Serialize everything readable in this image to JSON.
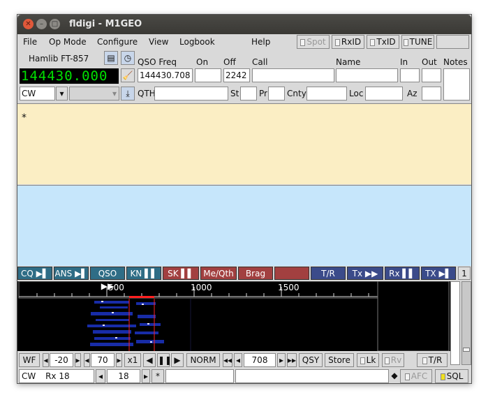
{
  "window": {
    "title": "fldigi - M1GEO"
  },
  "menu": {
    "file": "File",
    "op_mode": "Op Mode",
    "configure": "Configure",
    "view": "View",
    "logbook": "Logbook",
    "help": "Help"
  },
  "toolbar": {
    "spot": "Spot",
    "rxid": "RxID",
    "txid": "TxID",
    "tune": "TUNE"
  },
  "rig": {
    "name": "Hamlib FT-857",
    "frequency": "144430.000",
    "mode": "CW"
  },
  "log": {
    "qso_freq_label": "QSO Freq",
    "qso_freq": "144430.708",
    "on_label": "On",
    "on": "",
    "off_label": "Off",
    "off": "2242",
    "call_label": "Call",
    "call": "",
    "name_label": "Name",
    "name": "",
    "in_label": "In",
    "in": "",
    "out_label": "Out",
    "out": "",
    "notes_label": "Notes",
    "qth_label": "QTH",
    "st_label": "St",
    "pr_label": "Pr",
    "cnty_label": "Cnty",
    "loc_label": "Loc",
    "az_label": "Az"
  },
  "rx_text": "*",
  "macros": [
    {
      "label": "CQ ▶▌",
      "color": "#2f6d86"
    },
    {
      "label": "ANS ▶▌",
      "color": "#2f6d86"
    },
    {
      "label": "QSO ▶▶",
      "color": "#2f6d86"
    },
    {
      "label": "KN ▌▌",
      "color": "#2f6d86"
    },
    {
      "label": "SK ▌▌",
      "color": "#a24040"
    },
    {
      "label": "Me/Qth",
      "color": "#a24040"
    },
    {
      "label": "Brag",
      "color": "#a24040"
    },
    {
      "label": "",
      "color": "#a24040"
    },
    {
      "label": "T/R",
      "color": "#3b4b8a"
    },
    {
      "label": "Tx ▶▶",
      "color": "#3b4b8a"
    },
    {
      "label": "Rx ▌▌",
      "color": "#3b4b8a"
    },
    {
      "label": "TX ▶▌",
      "color": "#3b4b8a"
    }
  ],
  "macro_page": "1",
  "waterfall": {
    "scale_labels": [
      "500",
      "1000",
      "1500"
    ],
    "wf_button": "WF",
    "ref_level": "-20",
    "range": "70",
    "zoom": "x1",
    "norm": "NORM",
    "carrier": "708",
    "qsy": "QSY",
    "store": "Store",
    "lk": "Lk",
    "rv": "Rv",
    "tr": "T/R"
  },
  "status_bar": {
    "mode": "CW",
    "rx_label": "Rx 18",
    "wpm": "18",
    "star": "*",
    "afc": "AFC",
    "sql": "SQL"
  }
}
